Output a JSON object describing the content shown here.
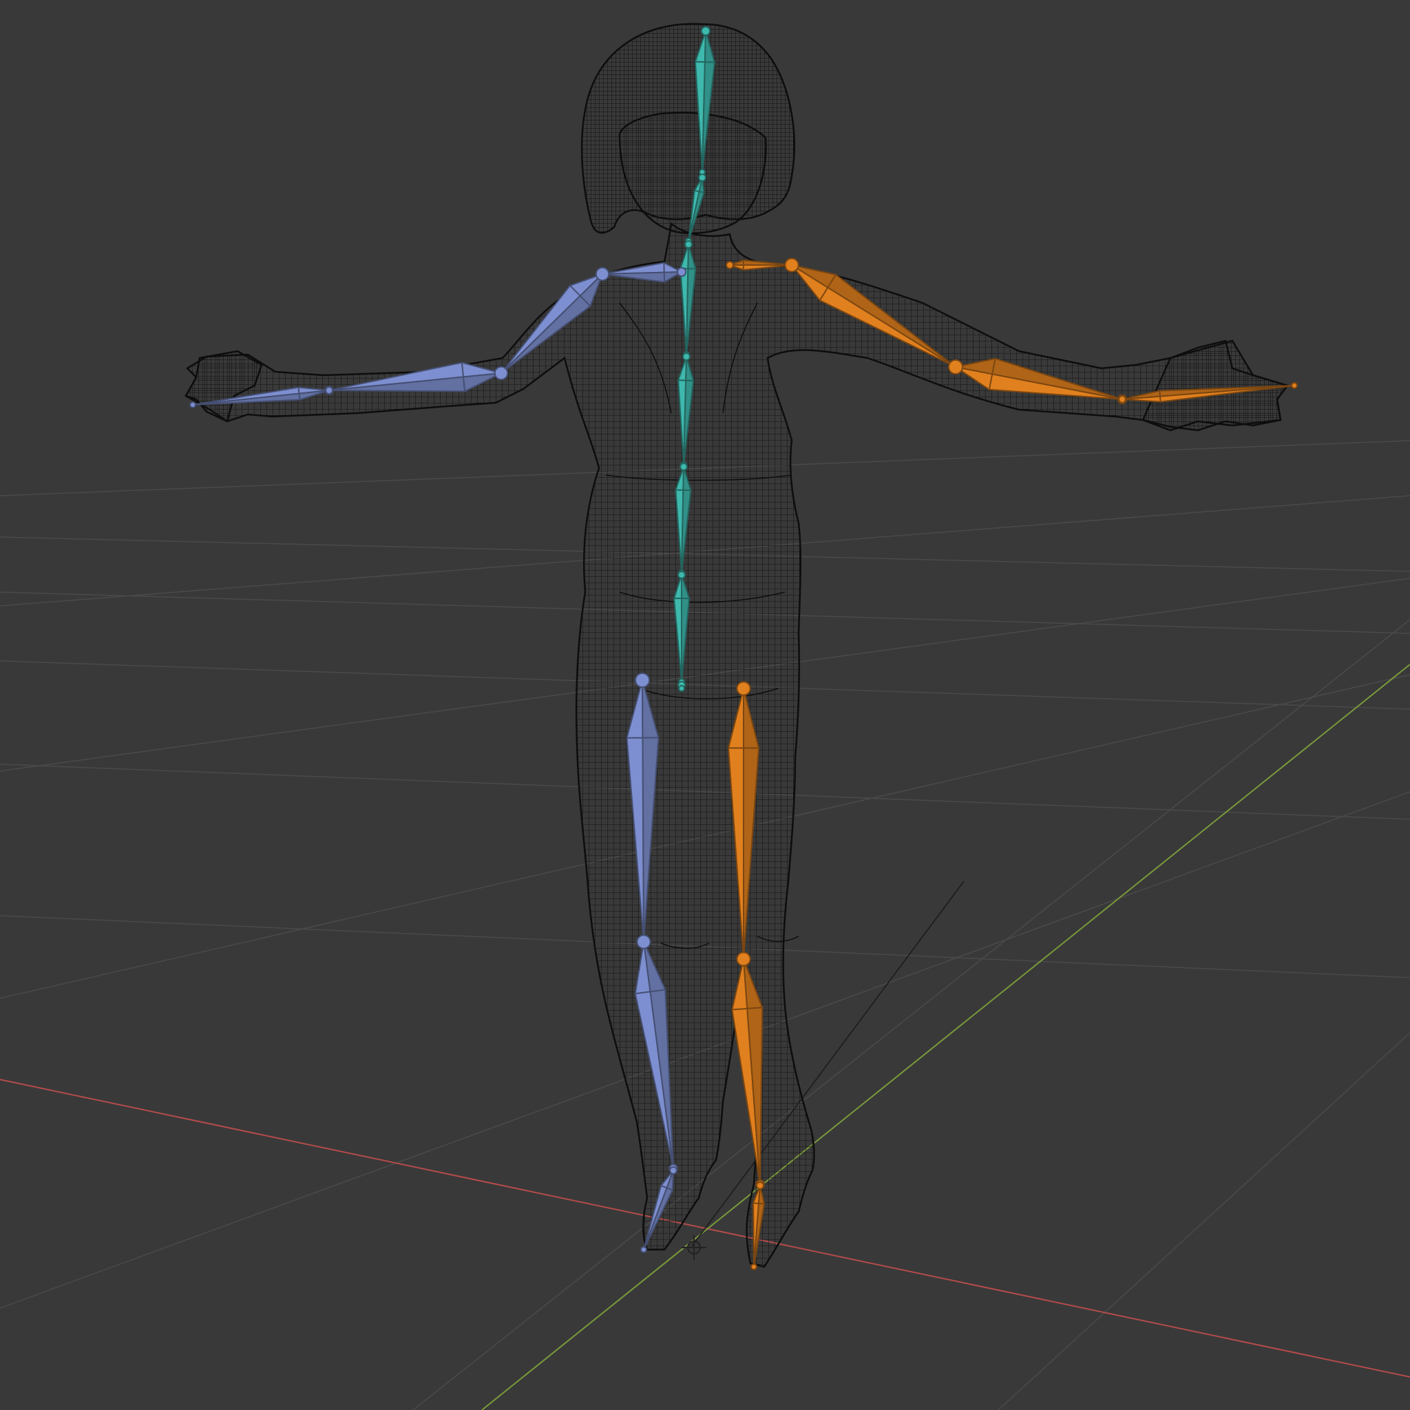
{
  "viewport": {
    "background": "#393939",
    "grid_color": "#4a4a4a",
    "x_axis_color": "#b54b4b",
    "y_axis_color": "#7a9a3a"
  },
  "mesh": {
    "wire_color": "#121212"
  },
  "armature": {
    "center_color": "#3fb8ad",
    "left_color": "#7d8fd0",
    "right_color": "#e0801e"
  },
  "bones": [
    {
      "name": "head",
      "side": "center"
    },
    {
      "name": "neck",
      "side": "center"
    },
    {
      "name": "chest",
      "side": "center"
    },
    {
      "name": "spine-upper",
      "side": "center"
    },
    {
      "name": "spine-mid",
      "side": "center"
    },
    {
      "name": "spine-lower",
      "side": "center"
    },
    {
      "name": "hips",
      "side": "center"
    },
    {
      "name": "shoulder-left",
      "side": "left"
    },
    {
      "name": "upper-arm-left",
      "side": "left"
    },
    {
      "name": "forearm-left",
      "side": "left"
    },
    {
      "name": "hand-left",
      "side": "left"
    },
    {
      "name": "thigh-left",
      "side": "left"
    },
    {
      "name": "shin-left",
      "side": "left"
    },
    {
      "name": "foot-left",
      "side": "left"
    },
    {
      "name": "shoulder-right",
      "side": "right"
    },
    {
      "name": "upper-arm-right",
      "side": "right"
    },
    {
      "name": "forearm-right",
      "side": "right"
    },
    {
      "name": "hand-right",
      "side": "right"
    },
    {
      "name": "thigh-right",
      "side": "right"
    },
    {
      "name": "shin-right",
      "side": "right"
    },
    {
      "name": "foot-right",
      "side": "right"
    }
  ]
}
